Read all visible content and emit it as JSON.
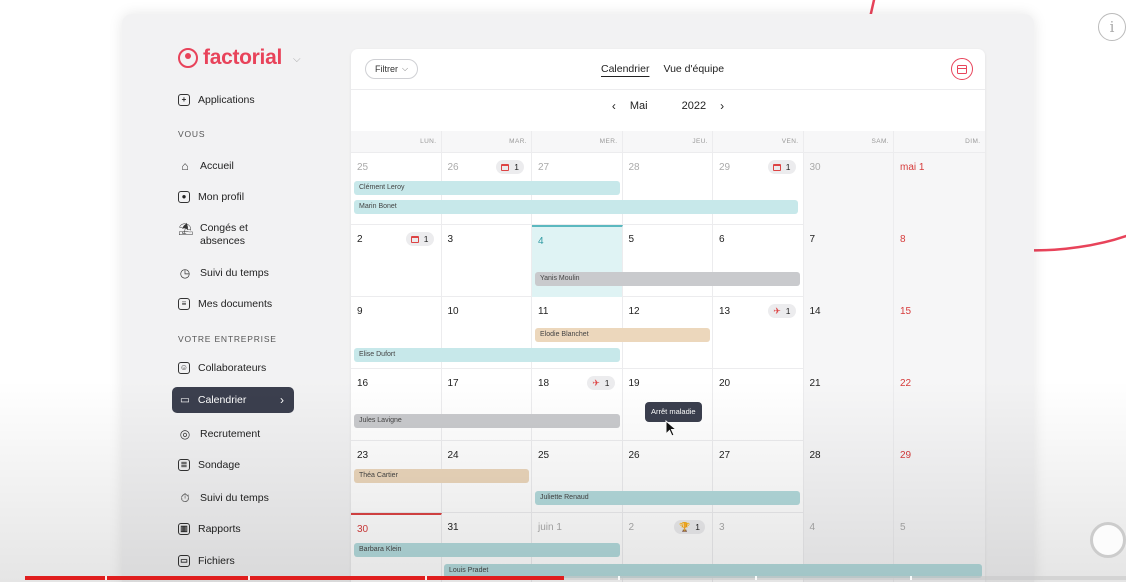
{
  "app": {
    "logo_text": "factorial",
    "brand_color": "#e8435a"
  },
  "sidebar": {
    "applications_label": "Applications",
    "section_you": "VOUS",
    "you_items": [
      {
        "label": "Accueil",
        "icon": "home-icon"
      },
      {
        "label": "Mon profil",
        "icon": "profile-icon"
      },
      {
        "label": "Congés et\nabsences",
        "icon": "leave-icon"
      },
      {
        "label": "Suivi du temps",
        "icon": "clock-icon"
      },
      {
        "label": "Mes documents",
        "icon": "documents-icon"
      }
    ],
    "section_company": "VOTRE ENTREPRISE",
    "company_items": [
      {
        "label": "Collaborateurs",
        "icon": "people-icon"
      },
      {
        "label": "Calendrier",
        "icon": "calendar-icon",
        "active": true
      },
      {
        "label": "Recrutement",
        "icon": "recruitment-icon"
      },
      {
        "label": "Sondage",
        "icon": "survey-icon"
      },
      {
        "label": "Suivi du temps",
        "icon": "stopwatch-icon"
      },
      {
        "label": "Rapports",
        "icon": "reports-icon"
      },
      {
        "label": "Fichiers",
        "icon": "files-icon"
      }
    ]
  },
  "toolbar": {
    "filter_label": "Filtrer",
    "tab_calendar": "Calendrier",
    "tab_team": "Vue d'équipe"
  },
  "month_nav": {
    "prev": "‹",
    "month": "Mai",
    "year": "2022",
    "next": "›"
  },
  "weekdays": [
    "LUN.",
    "MAR.",
    "MER.",
    "JEU.",
    "VEN.",
    "SAM.",
    "DIM."
  ],
  "weeks": [
    {
      "days": [
        "25",
        "26",
        "27",
        "28",
        "29",
        "30",
        "mai 1"
      ]
    },
    {
      "days": [
        "2",
        "3",
        "4",
        "5",
        "6",
        "7",
        "8"
      ]
    },
    {
      "days": [
        "9",
        "10",
        "11",
        "12",
        "13",
        "14",
        "15"
      ]
    },
    {
      "days": [
        "16",
        "17",
        "18",
        "19",
        "20",
        "21",
        "22"
      ]
    },
    {
      "days": [
        "23",
        "24",
        "25",
        "26",
        "27",
        "28",
        "29"
      ]
    },
    {
      "days": [
        "30",
        "31",
        "juin 1",
        "2",
        "3",
        "4",
        "5"
      ]
    }
  ],
  "badges": [
    {
      "count": "1",
      "icon": "calendar-icon"
    },
    {
      "count": "1",
      "icon": "calendar-icon"
    },
    {
      "count": "1",
      "icon": "calendar-icon"
    },
    {
      "count": "1",
      "icon": "plane-icon"
    },
    {
      "count": "1",
      "icon": "plane-icon"
    },
    {
      "count": "1",
      "icon": "trophy-icon"
    }
  ],
  "events": [
    "Clément Leroy",
    "Marin Bonet",
    "Yanis Moulin",
    "Elodie Blanchet",
    "Elise Dufort",
    "Jules Lavigne",
    "Théa Cartier",
    "Juliette Renaud",
    "Barbara Klein",
    "Louis Pradet"
  ],
  "tooltip": "Arrêt maladie",
  "progress": {
    "fraction": 0.49
  }
}
